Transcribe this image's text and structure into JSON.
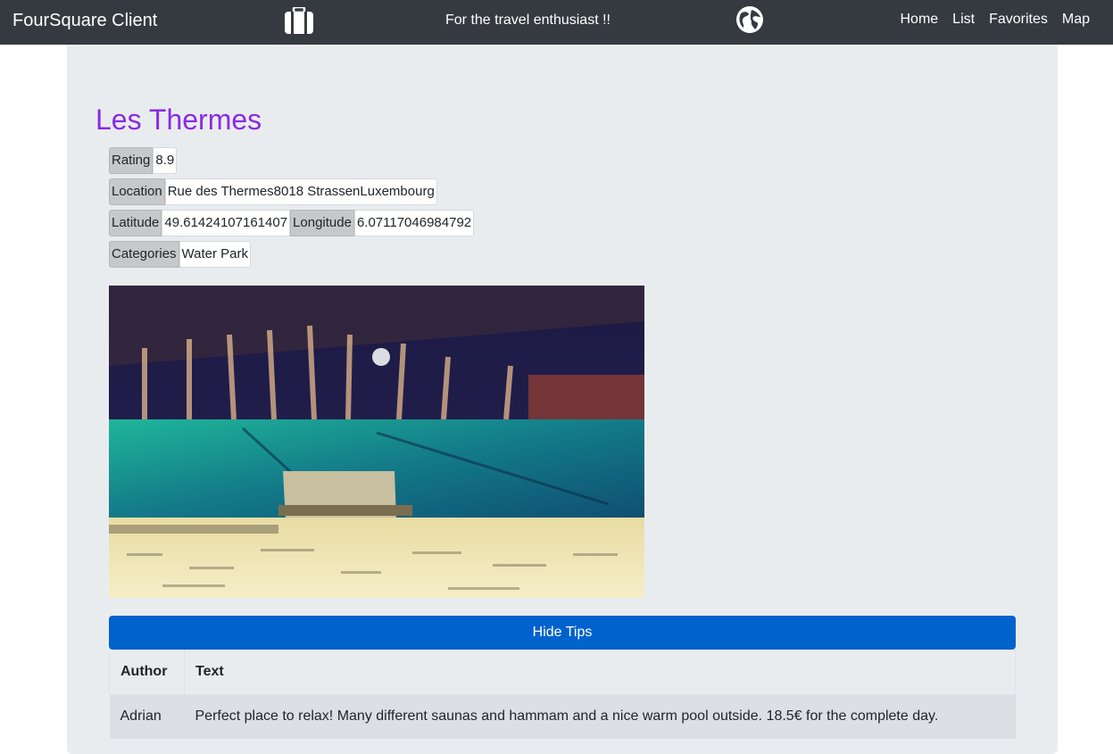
{
  "navbar": {
    "brand": "FourSquare Client",
    "tagline": "For the travel enthusiast !!",
    "links": [
      "Home",
      "List",
      "Favorites",
      "Map"
    ]
  },
  "venue": {
    "name": "Les Thermes",
    "rating_label": "Rating",
    "rating": "8.9",
    "location_label": "Location",
    "location": "Rue des Thermes8018 StrassenLuxembourg",
    "latitude_label": "Latitude",
    "latitude": "49.61424107161407",
    "longitude_label": "Longitude",
    "longitude": "6.07117046984792",
    "categories_label": "Categories",
    "categories": "Water Park"
  },
  "tips": {
    "toggle_label": "Hide Tips",
    "headers": [
      "Author",
      "Text"
    ],
    "rows": [
      {
        "author": "Adrian",
        "text": "Perfect place to relax! Many different saunas and hammam and a nice warm pool outside. 18.5€ for the complete day."
      }
    ]
  },
  "colors": {
    "navbar": "#343a40",
    "title": "#8a2be2",
    "button": "#0062cc",
    "jumbotron": "#e9ecef"
  }
}
